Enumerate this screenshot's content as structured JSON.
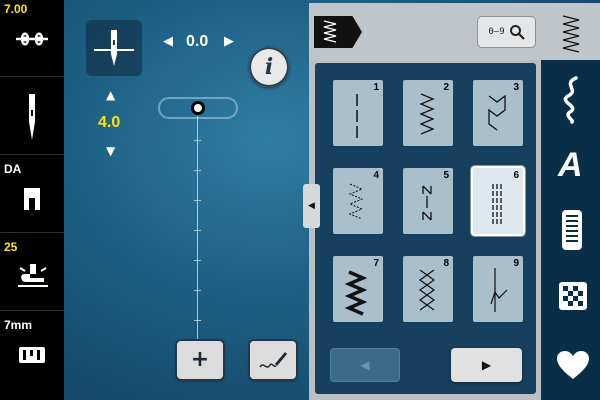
{
  "left_strip": {
    "thread_tension": {
      "value": "7.00",
      "icon": "thread-tension-icon"
    },
    "needle": {
      "icon": "needle-icon"
    },
    "presser_foot": {
      "label": "DA",
      "icon": "presser-foot-icon"
    },
    "presser_pressure": {
      "value": "25",
      "icon": "presser-foot-pressure-icon"
    },
    "feed_dog": {
      "value": "7mm",
      "icon": "feed-dog-icon"
    }
  },
  "center": {
    "needle_position": {
      "value": "0.0",
      "icon": "needle-position-icon"
    },
    "stitch_width": {
      "value": "4.0"
    },
    "info_label": "i",
    "plus_label": "+",
    "slider_icon": "stitch-length-slider-icon",
    "draw_icon": "stitch-designer-pen-icon"
  },
  "panel": {
    "category_icon": "practical-stitch-category-icon",
    "search_label": "0–9",
    "search_icon": "magnifier-icon",
    "selected_stitch": 6,
    "stitches": [
      {
        "num": "1",
        "name": "straight"
      },
      {
        "num": "2",
        "name": "zigzag"
      },
      {
        "num": "3",
        "name": "vari-overlock"
      },
      {
        "num": "4",
        "name": "running-stitch"
      },
      {
        "num": "5",
        "name": "securing-stitch"
      },
      {
        "num": "6",
        "name": "triple-straight"
      },
      {
        "num": "7",
        "name": "triple-zigzag"
      },
      {
        "num": "8",
        "name": "honeycomb"
      },
      {
        "num": "9",
        "name": "blind-stitch"
      }
    ],
    "prev_arrow": "◀",
    "next_arrow": "▶",
    "collapse_arrow": "◀"
  },
  "right_column": {
    "icons": [
      "practical-stitches-icon",
      "decorative-stitches-icon",
      "alphabets-icon",
      "buttonholes-icon",
      "quilt-stitches-icon",
      "favorites-heart-icon"
    ],
    "alphabet_letter": "A"
  },
  "colors": {
    "accent_yellow": "#ffe600",
    "background_blue": "#1d5d82",
    "panel_gray": "#b9bfc3",
    "grid_navy": "#17405e"
  }
}
